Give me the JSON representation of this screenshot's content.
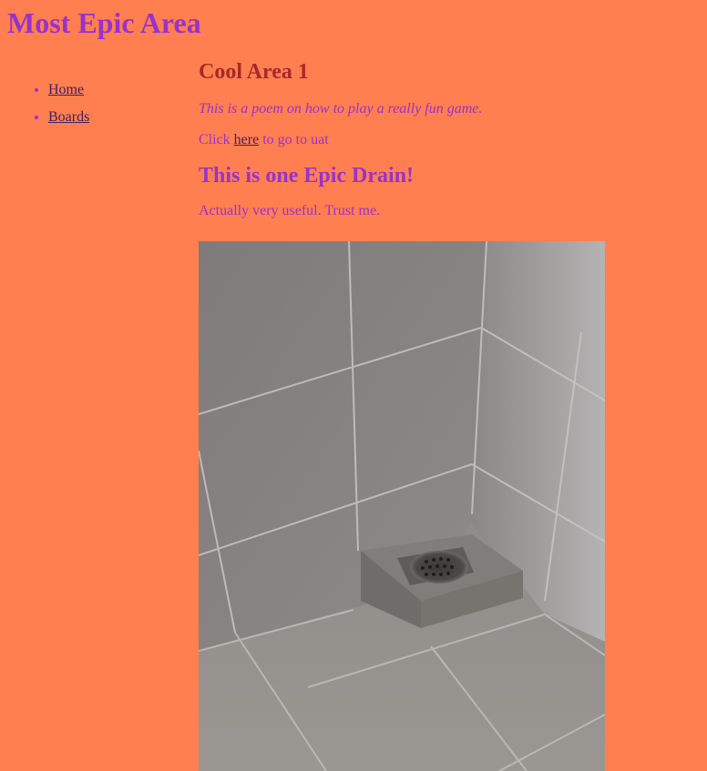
{
  "header": {
    "title": "Most Epic Area"
  },
  "nav": {
    "items": [
      {
        "label": "Home"
      },
      {
        "label": "Boards"
      }
    ]
  },
  "main": {
    "area_title": "Cool Area 1",
    "poem": "This is a poem on how to play a really fun game.",
    "click_prefix": "Click ",
    "click_link": "here",
    "click_suffix": " to go to uat",
    "drain_title": "This is one Epic Drain!",
    "drain_desc": "Actually very useful. Trust me."
  },
  "colors": {
    "background": "#ff7f50",
    "heading": "#9932cc",
    "section_heading": "#a52a2a",
    "link": "#3f1f5f"
  }
}
